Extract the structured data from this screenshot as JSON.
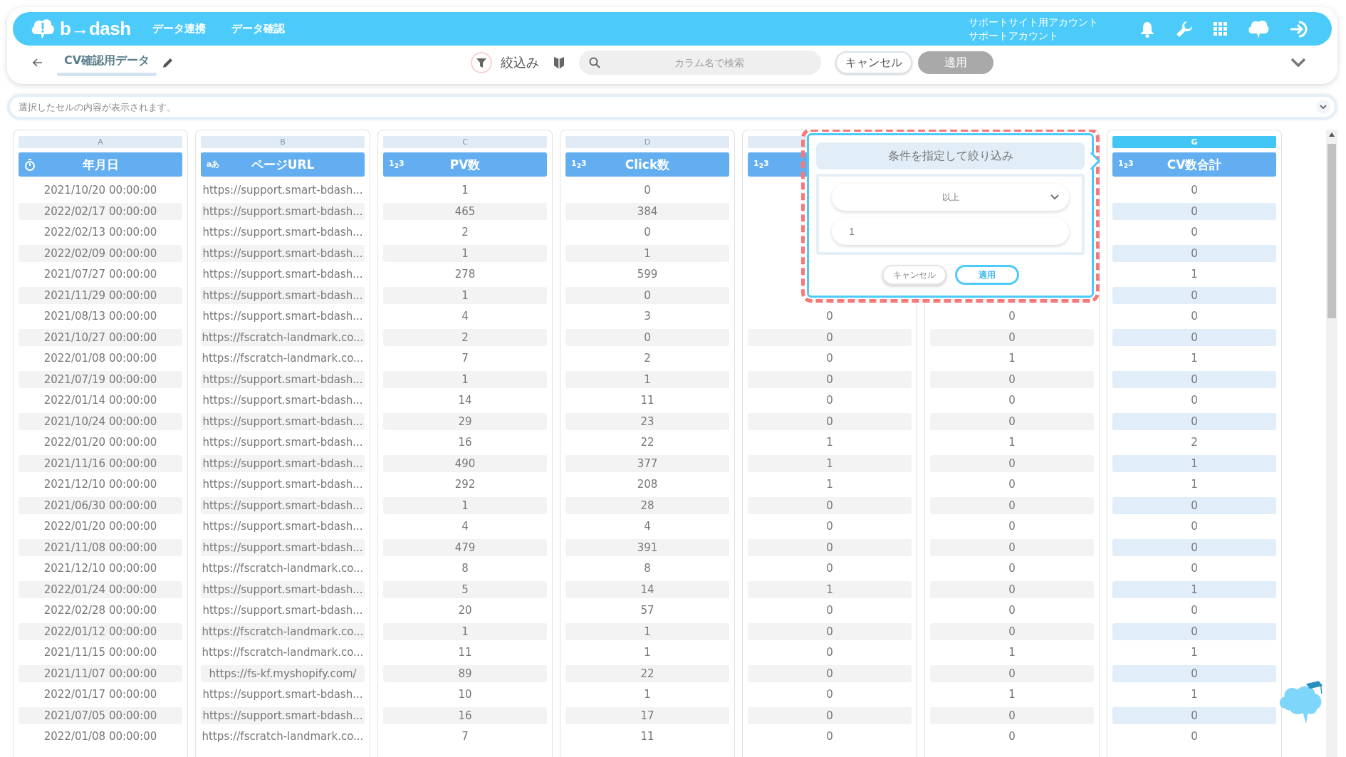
{
  "app_bar": {
    "logo": "b→dash",
    "nav": [
      {
        "label": "データ連携"
      },
      {
        "label": "データ確認"
      }
    ],
    "account": [
      "サポートサイト用アカウント",
      "サポートアカウント"
    ]
  },
  "toolbar": {
    "title": "CV確認用データ",
    "filter_label": "絞込み",
    "search": {
      "placeholder": "カラム名で検索"
    },
    "buttons": [
      {
        "label": "キャンセル",
        "disabled": false
      },
      {
        "label": "適用",
        "disabled": true
      }
    ]
  },
  "cell_viewer": {
    "placeholder": "選択したセルの内容が表示されます。"
  },
  "columns": [
    {
      "letter": "A",
      "name": "年月日",
      "kind": "datetime",
      "selected": false
    },
    {
      "letter": "B",
      "name": "ページURL",
      "kind": "string",
      "type_label": "aあ",
      "selected": false
    },
    {
      "letter": "C",
      "name": "PV数",
      "kind": "number",
      "type_label": "1$_{2}$3",
      "selected": false
    },
    {
      "letter": "D",
      "name": "Click数",
      "kind": "number",
      "type_label": "1$_{2}$3",
      "selected": false
    },
    {
      "kind": "number",
      "type_label": "1$_{2}$3",
      "selected": false
    },
    {
      "kind": "number"
    },
    {
      "letter": "G",
      "name": "CV数合計",
      "kind": "number",
      "type_label": "1$_{2}$3",
      "selected": true
    }
  ],
  "rows": [
    [
      "2021/10/20 00:00:00",
      "https://support.smart-bdash...",
      "1",
      "0",
      null,
      null,
      "0"
    ],
    [
      "2022/02/17 00:00:00",
      "https://support.smart-bdash...",
      "465",
      "384",
      null,
      null,
      "0"
    ],
    [
      "2022/02/13 00:00:00",
      "https://support.smart-bdash...",
      "2",
      "0",
      null,
      null,
      "0"
    ],
    [
      "2022/02/09 00:00:00",
      "https://support.smart-bdash...",
      "1",
      "1",
      null,
      null,
      "0"
    ],
    [
      "2021/07/27 00:00:00",
      "https://support.smart-bdash...",
      "278",
      "599",
      null,
      null,
      "1"
    ],
    [
      "2021/11/29 00:00:00",
      "https://support.smart-bdash...",
      "1",
      "0",
      null,
      null,
      "0"
    ],
    [
      "2021/08/13 00:00:00",
      "https://support.smart-bdash...",
      "4",
      "3",
      "0",
      "0",
      "0"
    ],
    [
      "2021/10/27 00:00:00",
      "https://fscratch-landmark.co...",
      "2",
      "0",
      "0",
      "0",
      "0"
    ],
    [
      "2022/01/08 00:00:00",
      "https://fscratch-landmark.co...",
      "7",
      "2",
      "0",
      "1",
      "1"
    ],
    [
      "2021/07/19 00:00:00",
      "https://support.smart-bdash...",
      "1",
      "1",
      "0",
      "0",
      "0"
    ],
    [
      "2022/01/14 00:00:00",
      "https://support.smart-bdash...",
      "14",
      "11",
      "0",
      "0",
      "0"
    ],
    [
      "2021/10/24 00:00:00",
      "https://support.smart-bdash...",
      "29",
      "23",
      "0",
      "0",
      "0"
    ],
    [
      "2022/01/20 00:00:00",
      "https://support.smart-bdash...",
      "16",
      "22",
      "1",
      "1",
      "2"
    ],
    [
      "2021/11/16 00:00:00",
      "https://support.smart-bdash...",
      "490",
      "377",
      "1",
      "0",
      "1"
    ],
    [
      "2021/12/10 00:00:00",
      "https://support.smart-bdash...",
      "292",
      "208",
      "1",
      "0",
      "1"
    ],
    [
      "2021/06/30 00:00:00",
      "https://support.smart-bdash...",
      "1",
      "28",
      "0",
      "0",
      "0"
    ],
    [
      "2022/01/20 00:00:00",
      "https://support.smart-bdash...",
      "4",
      "4",
      "0",
      "0",
      "0"
    ],
    [
      "2021/11/08 00:00:00",
      "https://support.smart-bdash...",
      "479",
      "391",
      "0",
      "0",
      "0"
    ],
    [
      "2021/12/10 00:00:00",
      "https://fscratch-landmark.co...",
      "8",
      "8",
      "0",
      "0",
      "0"
    ],
    [
      "2022/01/24 00:00:00",
      "https://support.smart-bdash...",
      "5",
      "14",
      "1",
      "0",
      "1"
    ],
    [
      "2022/02/28 00:00:00",
      "https://support.smart-bdash...",
      "20",
      "57",
      "0",
      "0",
      "0"
    ],
    [
      "2022/01/12 00:00:00",
      "https://fscratch-landmark.co...",
      "1",
      "1",
      "0",
      "0",
      "0"
    ],
    [
      "2021/11/15 00:00:00",
      "https://fscratch-landmark.co...",
      "11",
      "1",
      "0",
      "1",
      "1"
    ],
    [
      "2021/11/07 00:00:00",
      "https://fs-kf.myshopify.com/",
      "89",
      "22",
      "0",
      "0",
      "0"
    ],
    [
      "2022/01/17 00:00:00",
      "https://support.smart-bdash...",
      "10",
      "1",
      "0",
      "1",
      "1"
    ],
    [
      "2021/07/05 00:00:00",
      "https://support.smart-bdash...",
      "16",
      "17",
      "0",
      "0",
      "0"
    ],
    [
      "2022/01/08 00:00:00",
      "https://fscratch-landmark.co...",
      "7",
      "11",
      "0",
      "0",
      "0"
    ]
  ],
  "filter_popup": {
    "title": "条件を指定して絞り込み",
    "operator": "以上",
    "value": "1",
    "buttons": [
      {
        "label": "キャンセル",
        "kind": "secondary"
      },
      {
        "label": "適用",
        "kind": "primary"
      }
    ]
  }
}
